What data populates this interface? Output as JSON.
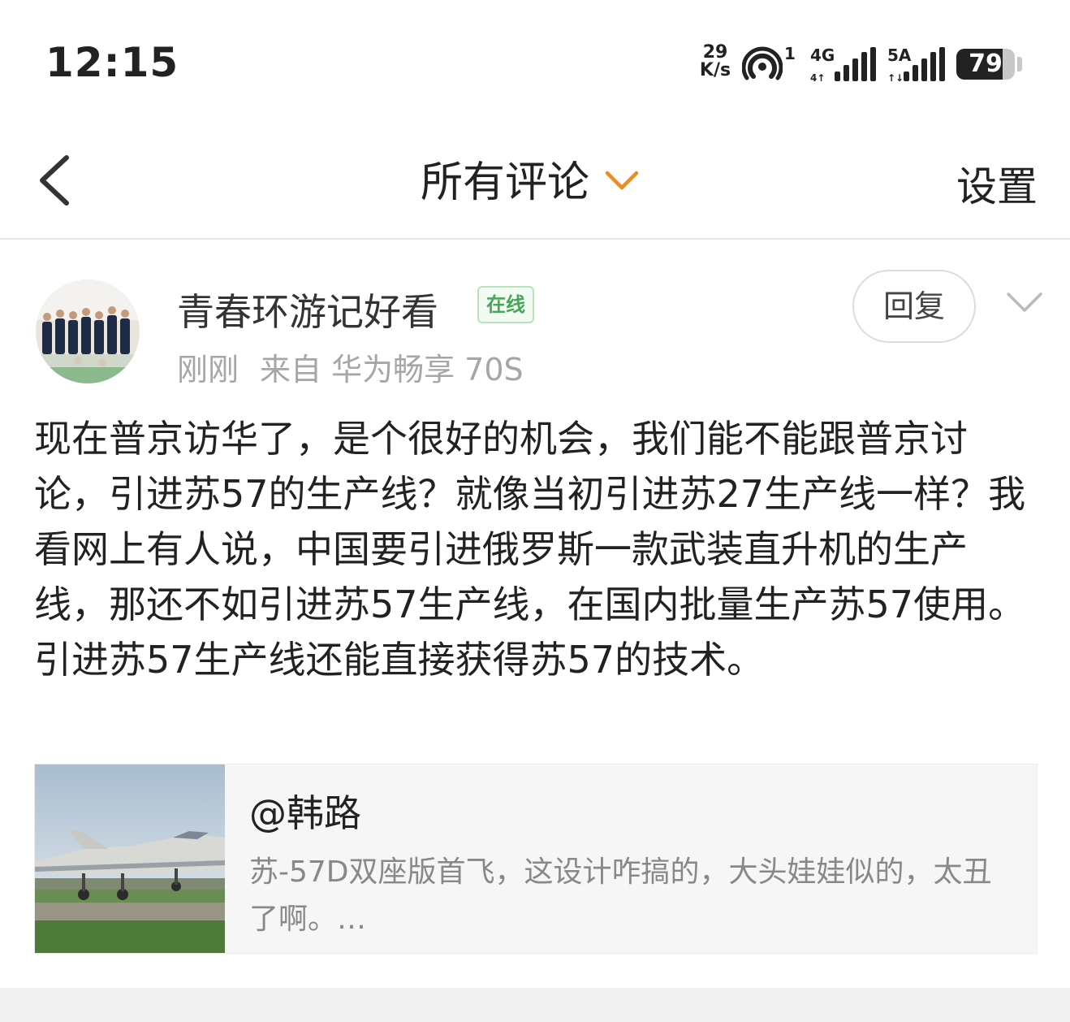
{
  "status_bar": {
    "time": "12:15",
    "net_speed_value": "29",
    "net_speed_unit": "K/s",
    "hotspot_count": "1",
    "sim1_label": "4G",
    "sim2_label": "5A",
    "battery_level": "79",
    "battery_fraction": 0.79
  },
  "header": {
    "title": "所有评论",
    "settings_label": "设置",
    "accent_color": "#f08a24"
  },
  "comment": {
    "username": "青春环游记好看",
    "online_badge": "在线",
    "time_ago": "刚刚",
    "source": "来自 华为畅享 70S",
    "reply_label": "回复",
    "text": "现在普京访华了，是个很好的机会，我们能不能跟普京讨论，引进苏57的生产线？就像当初引进苏27生产线一样？我看网上有人说，中国要引进俄罗斯一款武装直升机的生产线，那还不如引进苏57生产线，在国内批量生产苏57使用。引进苏57生产线还能直接获得苏57的技术。",
    "quote": {
      "author": "@韩路",
      "text": "苏-57D双座版首飞，这设计咋搞的，大头娃娃似的，太丑了啊。…"
    }
  }
}
